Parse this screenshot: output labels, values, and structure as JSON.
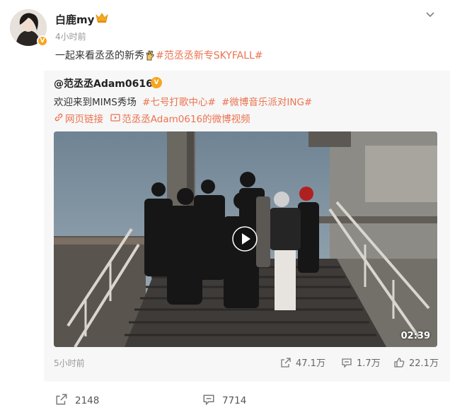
{
  "post": {
    "author": "白鹿my",
    "time": "4小时前",
    "text_prefix": "一起来看",
    "text_mention": "丞丞",
    "text_suffix": "的新秀",
    "hashtag": "#范丞丞新专SKYFALL#"
  },
  "repost": {
    "author": "@范丞丞Adam0616",
    "text": "欢迎来到MIMS秀场",
    "hashtags": [
      "#七号打歌中心#",
      "#微博音乐派对ING#"
    ],
    "link_label": "网页链接",
    "video_label": "范丞丞Adam0616的微博视频",
    "video_duration": "02:39",
    "time": "5小时前",
    "shares": "47.1万",
    "comments": "1.7万",
    "likes": "22.1万"
  },
  "actions": {
    "shares": "2148",
    "comments": "7714"
  },
  "colors": {
    "accent": "#eb7350",
    "verified": "#f7a51e"
  },
  "icons": [
    "crown-icon",
    "chevron-down-icon",
    "hand-icon",
    "link-icon",
    "video-icon",
    "play-icon",
    "share-icon",
    "comment-icon",
    "like-icon"
  ]
}
